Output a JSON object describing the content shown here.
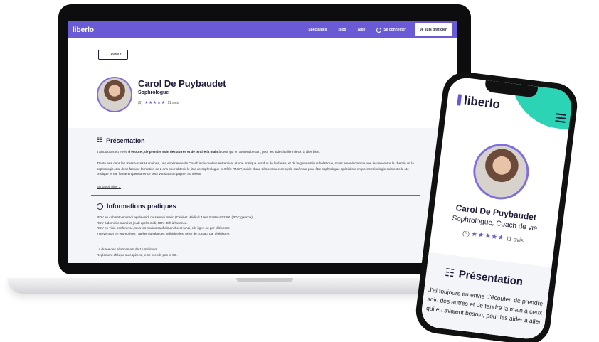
{
  "laptop": {
    "nav": {
      "logo": "liberlo",
      "links": [
        "Spécialités",
        "Blog",
        "Aide"
      ],
      "login": "Se connecter",
      "cta": "Je suis praticien"
    },
    "back": "Retour",
    "profile": {
      "name": "Carol De Puybaudet",
      "subtitle": "Sophrologue",
      "rating": "(5)",
      "stars": "★★★★★",
      "reviews": "11 avis"
    },
    "presentation": {
      "title": "Présentation",
      "p1_pre": "J'ai toujours eu envie ",
      "p1_bold": "d'écouter, de prendre soin des autres et de tendre la main",
      "p1_post": " à ceux qui en avaient besoin, pour les aider à aller mieux, à aller bien.",
      "p2": "Trente ans dans les Ressources Humaines, une expérience de Coach individuel en entreprise, et une pratique assidue de la danse, et de la gymnastique holistique, m'ont amené comme une évidence sur le chemin de la sophrologie. J'ai donc fait une formation de 2 ans pour obtenir le titre de sophrologue certifiée RNCP, suivie d'une 3ème année en cycle supérieur pour être sophrologue spécialiste en phénoménologie existentielle. Je pratique et me forme en permanence pour vous accompagner au mieux.",
      "more": "En savoir plus"
    },
    "info": {
      "title": "Informations pratiques",
      "lines": [
        "RDV en cabinet vendredi après-midi ou samedi matin (Cabinet Médical 4 ave Pasteur 92400 (RDC gauche)",
        "RDV à domicile mardi et jeudi après-midi, RDV 48h à l'avance.",
        "RDV en visio-conférence, tous les matins sauf dimanche et lundi, rdv ligne ou par téléphone.",
        "Intervention en entreprises : atelier ou séances individuelles, prise de contact par téléphone."
      ],
      "lines2": [
        "La durée des séances est de 1h minimum",
        "Règlement chèque ou espèces, je ne prends pas la CB."
      ]
    }
  },
  "phone": {
    "logo": "liberlo",
    "name": "Carol De Puybaudet",
    "subtitle": "Sophrologue, Coach de vie",
    "rating": "(5)",
    "stars": "★★★★★",
    "reviews": "11 avis",
    "section_title": "Présentation",
    "text_lines": [
      "J'ai toujours eu envie d'écouter, de prendre",
      "soin des autres et de tendre la main à ceux",
      "qui en avaient besoin, pour les aider à aller"
    ]
  },
  "colors": {
    "brand": "#6b5ad6",
    "accent": "#2bd4b4",
    "ink": "#1e1b3a"
  },
  "icons": [
    "arrow-left-icon",
    "user-circle-icon",
    "presentation-icon",
    "info-icon",
    "chevron-down-icon",
    "menu-icon",
    "star-icon"
  ]
}
